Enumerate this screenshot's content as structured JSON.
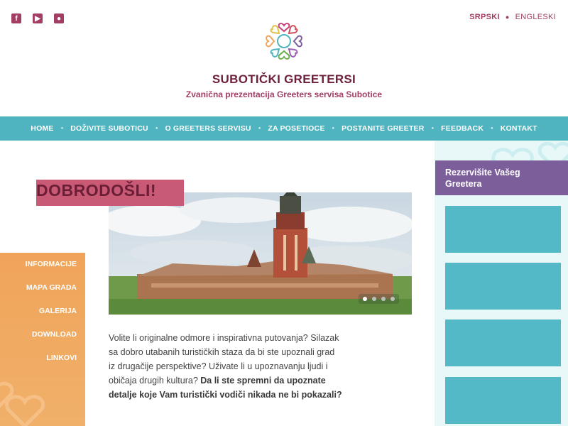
{
  "header": {
    "social": [
      {
        "name": "facebook-icon",
        "glyph": "f"
      },
      {
        "name": "youtube-icon",
        "glyph": "▶"
      },
      {
        "name": "flickr-icon",
        "glyph": "●"
      }
    ],
    "lang_active": "SRPSKI",
    "lang_inactive": "ENGLESKI",
    "title": "SUBOTIČKI GREETERSI",
    "subtitle": "Zvanična prezentacija Greeters servisa Subotice"
  },
  "nav": {
    "items": [
      "HOME",
      "DOŽIVITE SUBOTICU",
      "O GREETERS SERVISU",
      "ZA POSETIOCE",
      "POSTANITE GREETER",
      "FEEDBACK",
      "KONTAKT"
    ]
  },
  "main": {
    "welcome": "DOBRODOŠLI!",
    "intro_plain": "Volite li originalne odmore i inspirativna putovanja? Silazak sa dobro utabanih turističkih staza da bi ste upoznali grad iz drugačije perspektive? Uživate li u upoznavanju ljudi i običaja drugih kultura? ",
    "intro_bold": "Da li ste spremni da upoznate detalje koje Vam turistički vodiči nikada ne bi pokazali?"
  },
  "sidemenu": {
    "items": [
      "INFORMACIJE",
      "MAPA GRADA",
      "GALERIJA",
      "DOWNLOAD",
      "LINKOVI"
    ]
  },
  "sidebar": {
    "book_title": "Rezervišite Vašeg Greetera"
  },
  "colors": {
    "brand_plum": "#6e1f3c",
    "brand_pink": "#a23d63",
    "nav_teal": "#4fb4bf",
    "side_orange": "#f0a459",
    "sidebar_purple": "#7b5e9a",
    "tile_teal": "#54b9c6"
  }
}
